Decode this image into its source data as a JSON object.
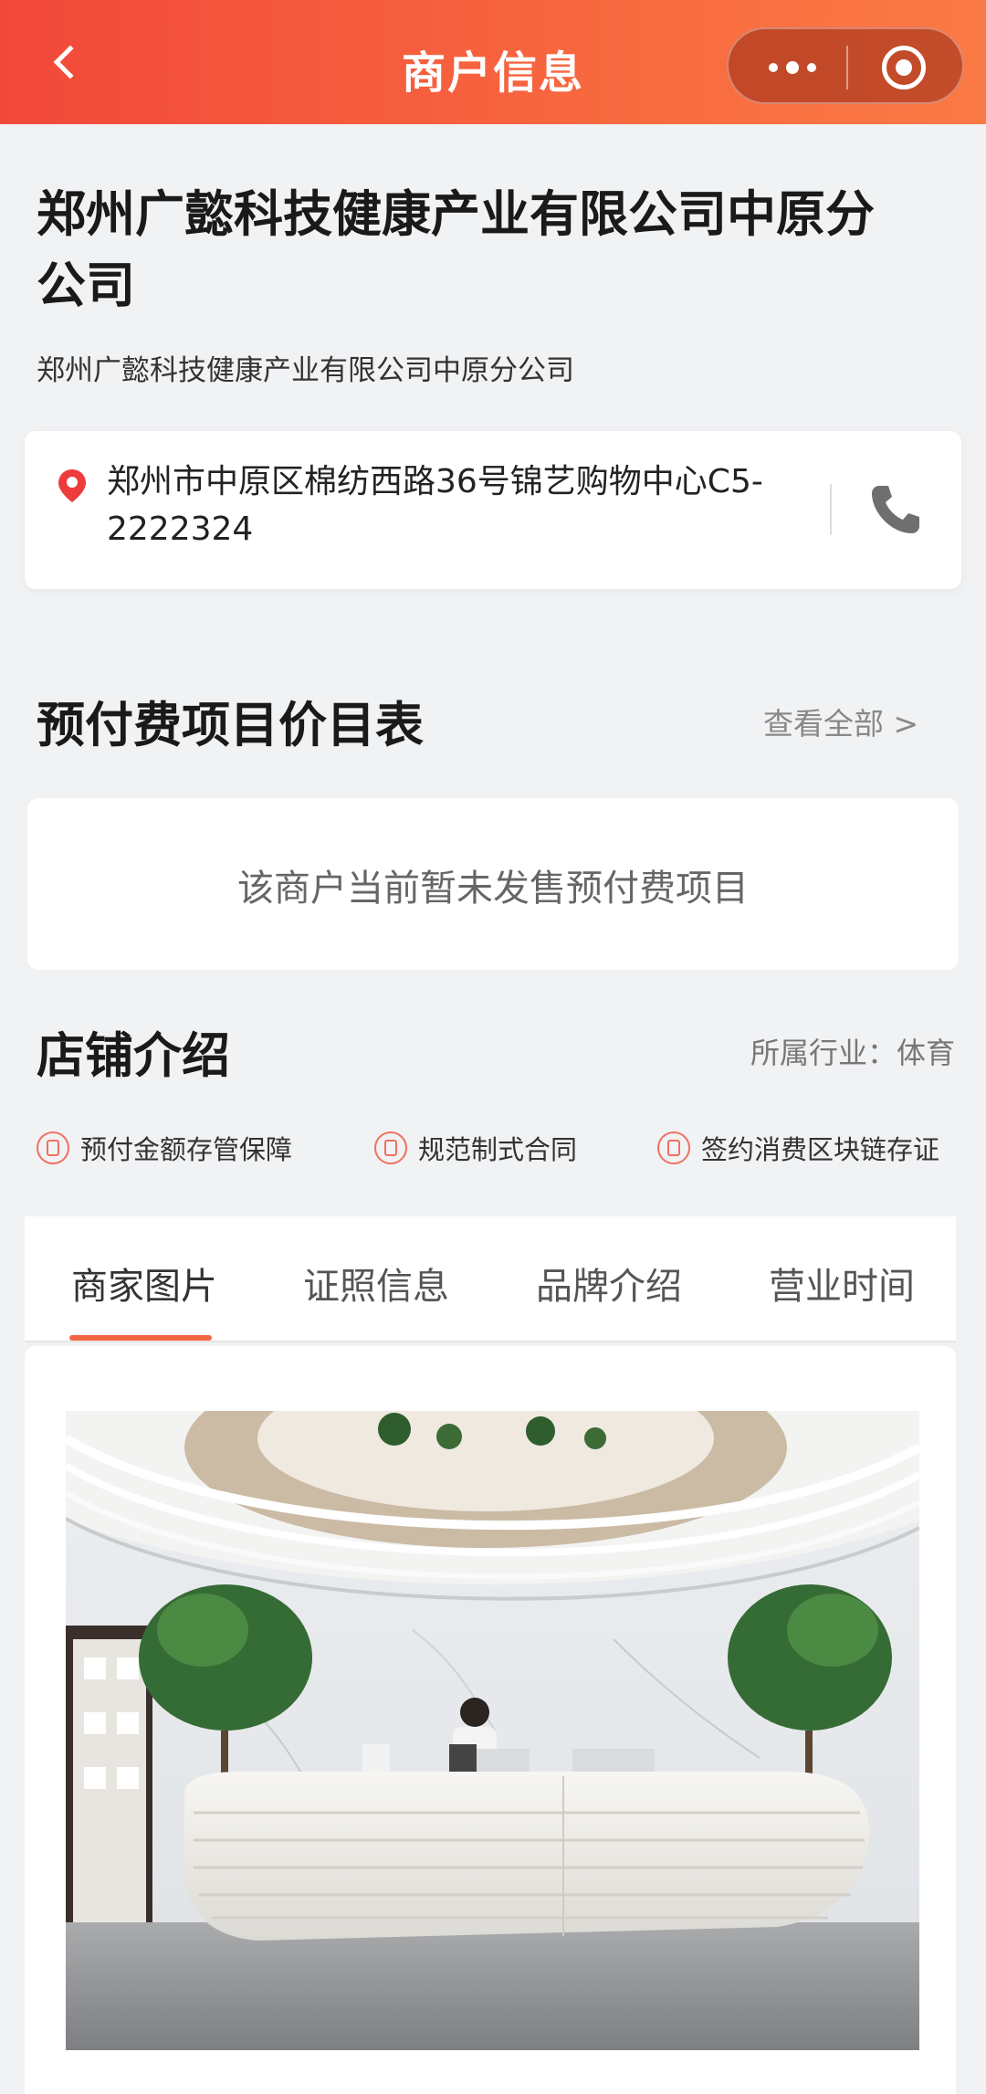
{
  "nav": {
    "title": "商户信息"
  },
  "merchant": {
    "name": "郑州广懿科技健康产业有限公司中原分公司",
    "subtitle": "郑州广懿科技健康产业有限公司中原分公司",
    "address": "郑州市中原区棉纺西路36号锦艺购物中心C5-2222324"
  },
  "prepaid": {
    "title": "预付费项目价目表",
    "view_all": "查看全部 >",
    "empty": "该商户当前暂未发售预付费项目"
  },
  "store": {
    "title": "店铺介绍",
    "industry": "所属行业：体育",
    "badges": [
      "预付金额存管保障",
      "规范制式合同",
      "签约消费区块链存证"
    ]
  },
  "tabs": [
    "商家图片",
    "证照信息",
    "品牌介绍",
    "营业时间"
  ],
  "active_tab": "商家图片",
  "colors": {
    "accent": "#f26644",
    "header_start": "#f2483a",
    "header_end": "#fb7a45"
  }
}
